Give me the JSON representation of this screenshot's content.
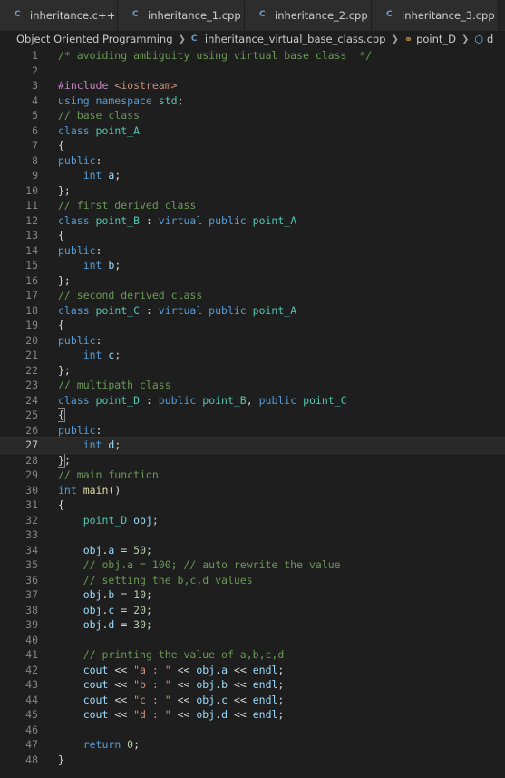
{
  "tabs": [
    {
      "label": "inheritance.c++",
      "icon": "c-plus-plus-icon"
    },
    {
      "label": "inheritance_1.cpp",
      "icon": "c-plus-plus-icon"
    },
    {
      "label": "inheritance_2.cpp",
      "icon": "c-plus-plus-icon"
    },
    {
      "label": "inheritance_3.cpp",
      "icon": "c-plus-plus-icon"
    }
  ],
  "breadcrumb": {
    "folder": "Object Oriented Programming",
    "file": "inheritance_virtual_base_class.cpp",
    "symbol": "point_D",
    "member": "d"
  },
  "active_line": 27,
  "lines": [
    {
      "n": "1",
      "tokens": [
        [
          "cm",
          "/* avoiding ambiguity using virtual base class  */"
        ]
      ]
    },
    {
      "n": "2",
      "tokens": []
    },
    {
      "n": "3",
      "tokens": [
        [
          "pp",
          "#include "
        ],
        [
          "inc",
          "<iostream>"
        ]
      ]
    },
    {
      "n": "4",
      "tokens": [
        [
          "kw",
          "using namespace "
        ],
        [
          "ty",
          "std"
        ],
        [
          "pl",
          ";"
        ]
      ]
    },
    {
      "n": "5",
      "tokens": [
        [
          "cm",
          "// base class"
        ]
      ]
    },
    {
      "n": "6",
      "tokens": [
        [
          "kw",
          "class "
        ],
        [
          "ty",
          "point_A"
        ]
      ]
    },
    {
      "n": "7",
      "tokens": [
        [
          "pl",
          "{"
        ]
      ]
    },
    {
      "n": "8",
      "tokens": [
        [
          "kw",
          "public"
        ],
        [
          "pl",
          ":"
        ]
      ]
    },
    {
      "n": "9",
      "tokens": [
        [
          "pl",
          "    "
        ],
        [
          "kw",
          "int "
        ],
        [
          "var",
          "a"
        ],
        [
          "pl",
          ";"
        ]
      ]
    },
    {
      "n": "10",
      "tokens": [
        [
          "pl",
          "};"
        ]
      ]
    },
    {
      "n": "11",
      "tokens": [
        [
          "cm",
          "// first derived class"
        ]
      ]
    },
    {
      "n": "12",
      "tokens": [
        [
          "kw",
          "class "
        ],
        [
          "ty",
          "point_B"
        ],
        [
          "pl",
          " : "
        ],
        [
          "kw",
          "virtual public "
        ],
        [
          "ty",
          "point_A"
        ]
      ]
    },
    {
      "n": "13",
      "tokens": [
        [
          "pl",
          "{"
        ]
      ]
    },
    {
      "n": "14",
      "tokens": [
        [
          "kw",
          "public"
        ],
        [
          "pl",
          ":"
        ]
      ]
    },
    {
      "n": "15",
      "tokens": [
        [
          "pl",
          "    "
        ],
        [
          "kw",
          "int "
        ],
        [
          "var",
          "b"
        ],
        [
          "pl",
          ";"
        ]
      ]
    },
    {
      "n": "16",
      "tokens": [
        [
          "pl",
          "};"
        ]
      ]
    },
    {
      "n": "17",
      "tokens": [
        [
          "cm",
          "// second derived class"
        ]
      ]
    },
    {
      "n": "18",
      "tokens": [
        [
          "kw",
          "class "
        ],
        [
          "ty",
          "point_C"
        ],
        [
          "pl",
          " : "
        ],
        [
          "kw",
          "virtual public "
        ],
        [
          "ty",
          "point_A"
        ]
      ]
    },
    {
      "n": "19",
      "tokens": [
        [
          "pl",
          "{"
        ]
      ]
    },
    {
      "n": "20",
      "tokens": [
        [
          "kw",
          "public"
        ],
        [
          "pl",
          ":"
        ]
      ]
    },
    {
      "n": "21",
      "tokens": [
        [
          "pl",
          "    "
        ],
        [
          "kw",
          "int "
        ],
        [
          "var",
          "c"
        ],
        [
          "pl",
          ";"
        ]
      ]
    },
    {
      "n": "22",
      "tokens": [
        [
          "pl",
          "};"
        ]
      ]
    },
    {
      "n": "23",
      "tokens": [
        [
          "cm",
          "// multipath class"
        ]
      ]
    },
    {
      "n": "24",
      "tokens": [
        [
          "kw",
          "class "
        ],
        [
          "ty",
          "point_D"
        ],
        [
          "pl",
          " : "
        ],
        [
          "kw",
          "public "
        ],
        [
          "ty",
          "point_B"
        ],
        [
          "pl",
          ", "
        ],
        [
          "kw",
          "public "
        ],
        [
          "ty",
          "point_C"
        ]
      ]
    },
    {
      "n": "25",
      "tokens": [
        [
          "brk",
          "{"
        ]
      ]
    },
    {
      "n": "26",
      "tokens": [
        [
          "kw",
          "public"
        ],
        [
          "pl",
          ":"
        ]
      ]
    },
    {
      "n": "27",
      "tokens": [
        [
          "pl",
          "    "
        ],
        [
          "kw",
          "int "
        ],
        [
          "var",
          "d"
        ],
        [
          "pl",
          ";"
        ],
        [
          "cur",
          ""
        ]
      ]
    },
    {
      "n": "28",
      "tokens": [
        [
          "brk",
          "}"
        ],
        [
          "pl",
          ";"
        ]
      ]
    },
    {
      "n": "29",
      "tokens": [
        [
          "cm",
          "// main function"
        ]
      ]
    },
    {
      "n": "30",
      "tokens": [
        [
          "kw",
          "int "
        ],
        [
          "fn",
          "main"
        ],
        [
          "pl",
          "()"
        ]
      ]
    },
    {
      "n": "31",
      "tokens": [
        [
          "pl",
          "{"
        ]
      ]
    },
    {
      "n": "32",
      "tokens": [
        [
          "pl",
          "    "
        ],
        [
          "ty",
          "point_D "
        ],
        [
          "var",
          "obj"
        ],
        [
          "pl",
          ";"
        ]
      ]
    },
    {
      "n": "33",
      "tokens": []
    },
    {
      "n": "34",
      "tokens": [
        [
          "pl",
          "    "
        ],
        [
          "var",
          "obj"
        ],
        [
          "pl",
          "."
        ],
        [
          "var",
          "a"
        ],
        [
          "pl",
          " = "
        ],
        [
          "num",
          "50"
        ],
        [
          "pl",
          ";"
        ]
      ]
    },
    {
      "n": "35",
      "tokens": [
        [
          "pl",
          "    "
        ],
        [
          "cm",
          "// obj.a = 100; // auto rewrite the value"
        ]
      ]
    },
    {
      "n": "36",
      "tokens": [
        [
          "pl",
          "    "
        ],
        [
          "cm",
          "// setting the b,c,d values"
        ]
      ]
    },
    {
      "n": "37",
      "tokens": [
        [
          "pl",
          "    "
        ],
        [
          "var",
          "obj"
        ],
        [
          "pl",
          "."
        ],
        [
          "var",
          "b"
        ],
        [
          "pl",
          " = "
        ],
        [
          "num",
          "10"
        ],
        [
          "pl",
          ";"
        ]
      ]
    },
    {
      "n": "38",
      "tokens": [
        [
          "pl",
          "    "
        ],
        [
          "var",
          "obj"
        ],
        [
          "pl",
          "."
        ],
        [
          "var",
          "c"
        ],
        [
          "pl",
          " = "
        ],
        [
          "num",
          "20"
        ],
        [
          "pl",
          ";"
        ]
      ]
    },
    {
      "n": "39",
      "tokens": [
        [
          "pl",
          "    "
        ],
        [
          "var",
          "obj"
        ],
        [
          "pl",
          "."
        ],
        [
          "var",
          "d"
        ],
        [
          "pl",
          " = "
        ],
        [
          "num",
          "30"
        ],
        [
          "pl",
          ";"
        ]
      ]
    },
    {
      "n": "40",
      "tokens": []
    },
    {
      "n": "41",
      "tokens": [
        [
          "pl",
          "    "
        ],
        [
          "cm",
          "// printing the value of a,b,c,d"
        ]
      ]
    },
    {
      "n": "42",
      "tokens": [
        [
          "pl",
          "    "
        ],
        [
          "var",
          "cout"
        ],
        [
          "pl",
          " << "
        ],
        [
          "str",
          "\"a : \""
        ],
        [
          "pl",
          " << "
        ],
        [
          "var",
          "obj"
        ],
        [
          "pl",
          "."
        ],
        [
          "var",
          "a"
        ],
        [
          "pl",
          " << "
        ],
        [
          "var",
          "endl"
        ],
        [
          "pl",
          ";"
        ]
      ]
    },
    {
      "n": "43",
      "tokens": [
        [
          "pl",
          "    "
        ],
        [
          "var",
          "cout"
        ],
        [
          "pl",
          " << "
        ],
        [
          "str",
          "\"b : \""
        ],
        [
          "pl",
          " << "
        ],
        [
          "var",
          "obj"
        ],
        [
          "pl",
          "."
        ],
        [
          "var",
          "b"
        ],
        [
          "pl",
          " << "
        ],
        [
          "var",
          "endl"
        ],
        [
          "pl",
          ";"
        ]
      ]
    },
    {
      "n": "44",
      "tokens": [
        [
          "pl",
          "    "
        ],
        [
          "var",
          "cout"
        ],
        [
          "pl",
          " << "
        ],
        [
          "str",
          "\"c : \""
        ],
        [
          "pl",
          " << "
        ],
        [
          "var",
          "obj"
        ],
        [
          "pl",
          "."
        ],
        [
          "var",
          "c"
        ],
        [
          "pl",
          " << "
        ],
        [
          "var",
          "endl"
        ],
        [
          "pl",
          ";"
        ]
      ]
    },
    {
      "n": "45",
      "tokens": [
        [
          "pl",
          "    "
        ],
        [
          "var",
          "cout"
        ],
        [
          "pl",
          " << "
        ],
        [
          "str",
          "\"d : \""
        ],
        [
          "pl",
          " << "
        ],
        [
          "var",
          "obj"
        ],
        [
          "pl",
          "."
        ],
        [
          "var",
          "d"
        ],
        [
          "pl",
          " << "
        ],
        [
          "var",
          "endl"
        ],
        [
          "pl",
          ";"
        ]
      ]
    },
    {
      "n": "46",
      "tokens": []
    },
    {
      "n": "47",
      "tokens": [
        [
          "pl",
          "    "
        ],
        [
          "kw",
          "return "
        ],
        [
          "num",
          "0"
        ],
        [
          "pl",
          ";"
        ]
      ]
    },
    {
      "n": "48",
      "tokens": [
        [
          "pl",
          "}"
        ]
      ]
    }
  ],
  "colors": {
    "background": "#1e1e1e",
    "comment": "#6a9955",
    "keyword": "#569cd6",
    "type": "#4ec9b0",
    "function": "#dcdcaa",
    "number": "#b5cea8",
    "string": "#ce9178",
    "variable": "#9cdcfe"
  }
}
